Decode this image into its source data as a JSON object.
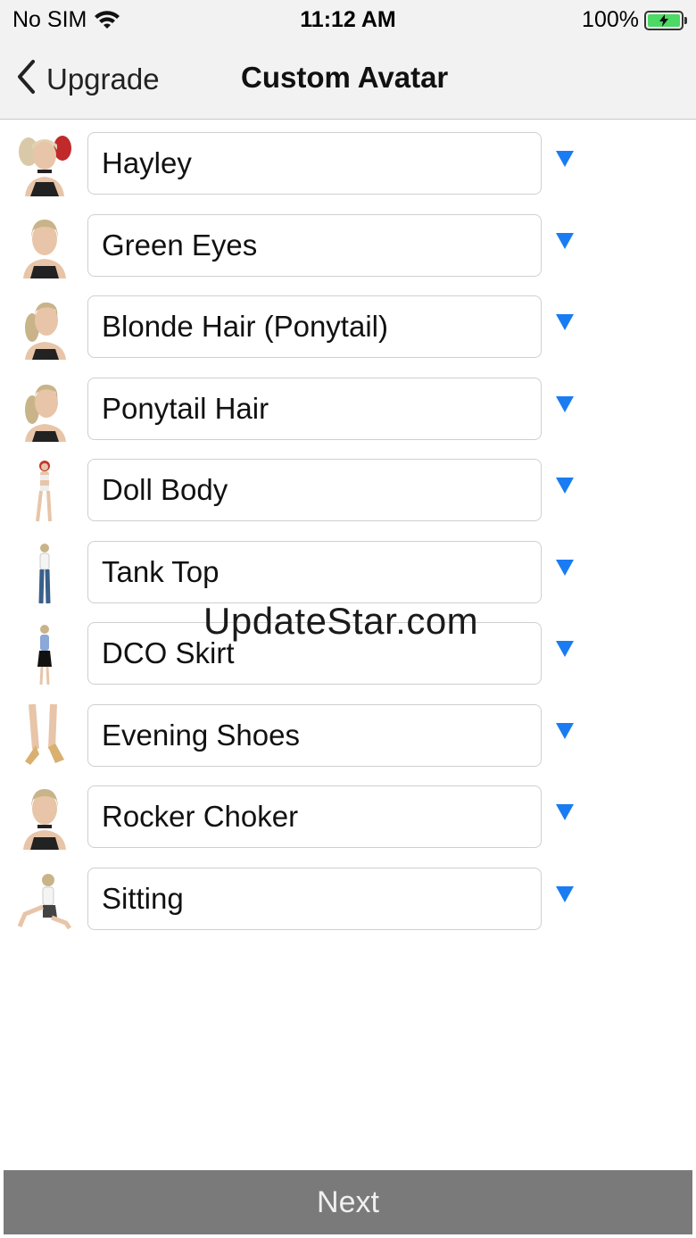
{
  "status": {
    "carrier": "No SIM",
    "time": "11:12 AM",
    "battery": "100%"
  },
  "nav": {
    "back_label": "Upgrade",
    "title": "Custom Avatar"
  },
  "items": [
    {
      "label": "Hayley",
      "thumb": "hayley-avatar"
    },
    {
      "label": "Green Eyes",
      "thumb": "green-eyes-avatar"
    },
    {
      "label": "Blonde Hair (Ponytail)",
      "thumb": "blonde-ponytail-avatar"
    },
    {
      "label": "Ponytail Hair",
      "thumb": "ponytail-hair-avatar"
    },
    {
      "label": "Doll Body",
      "thumb": "doll-body-avatar"
    },
    {
      "label": "Tank Top",
      "thumb": "tank-top-avatar"
    },
    {
      "label": "DCO Skirt",
      "thumb": "dco-skirt-avatar"
    },
    {
      "label": "Evening Shoes",
      "thumb": "evening-shoes-avatar"
    },
    {
      "label": "Rocker Choker",
      "thumb": "rocker-choker-avatar"
    },
    {
      "label": "Sitting",
      "thumb": "sitting-avatar"
    }
  ],
  "watermark": "UpdateStar.com",
  "next_label": "Next",
  "colors": {
    "accent": "#1a7cf2",
    "bar_bg": "#f2f2f2",
    "next_bg": "#7a7a7a"
  }
}
